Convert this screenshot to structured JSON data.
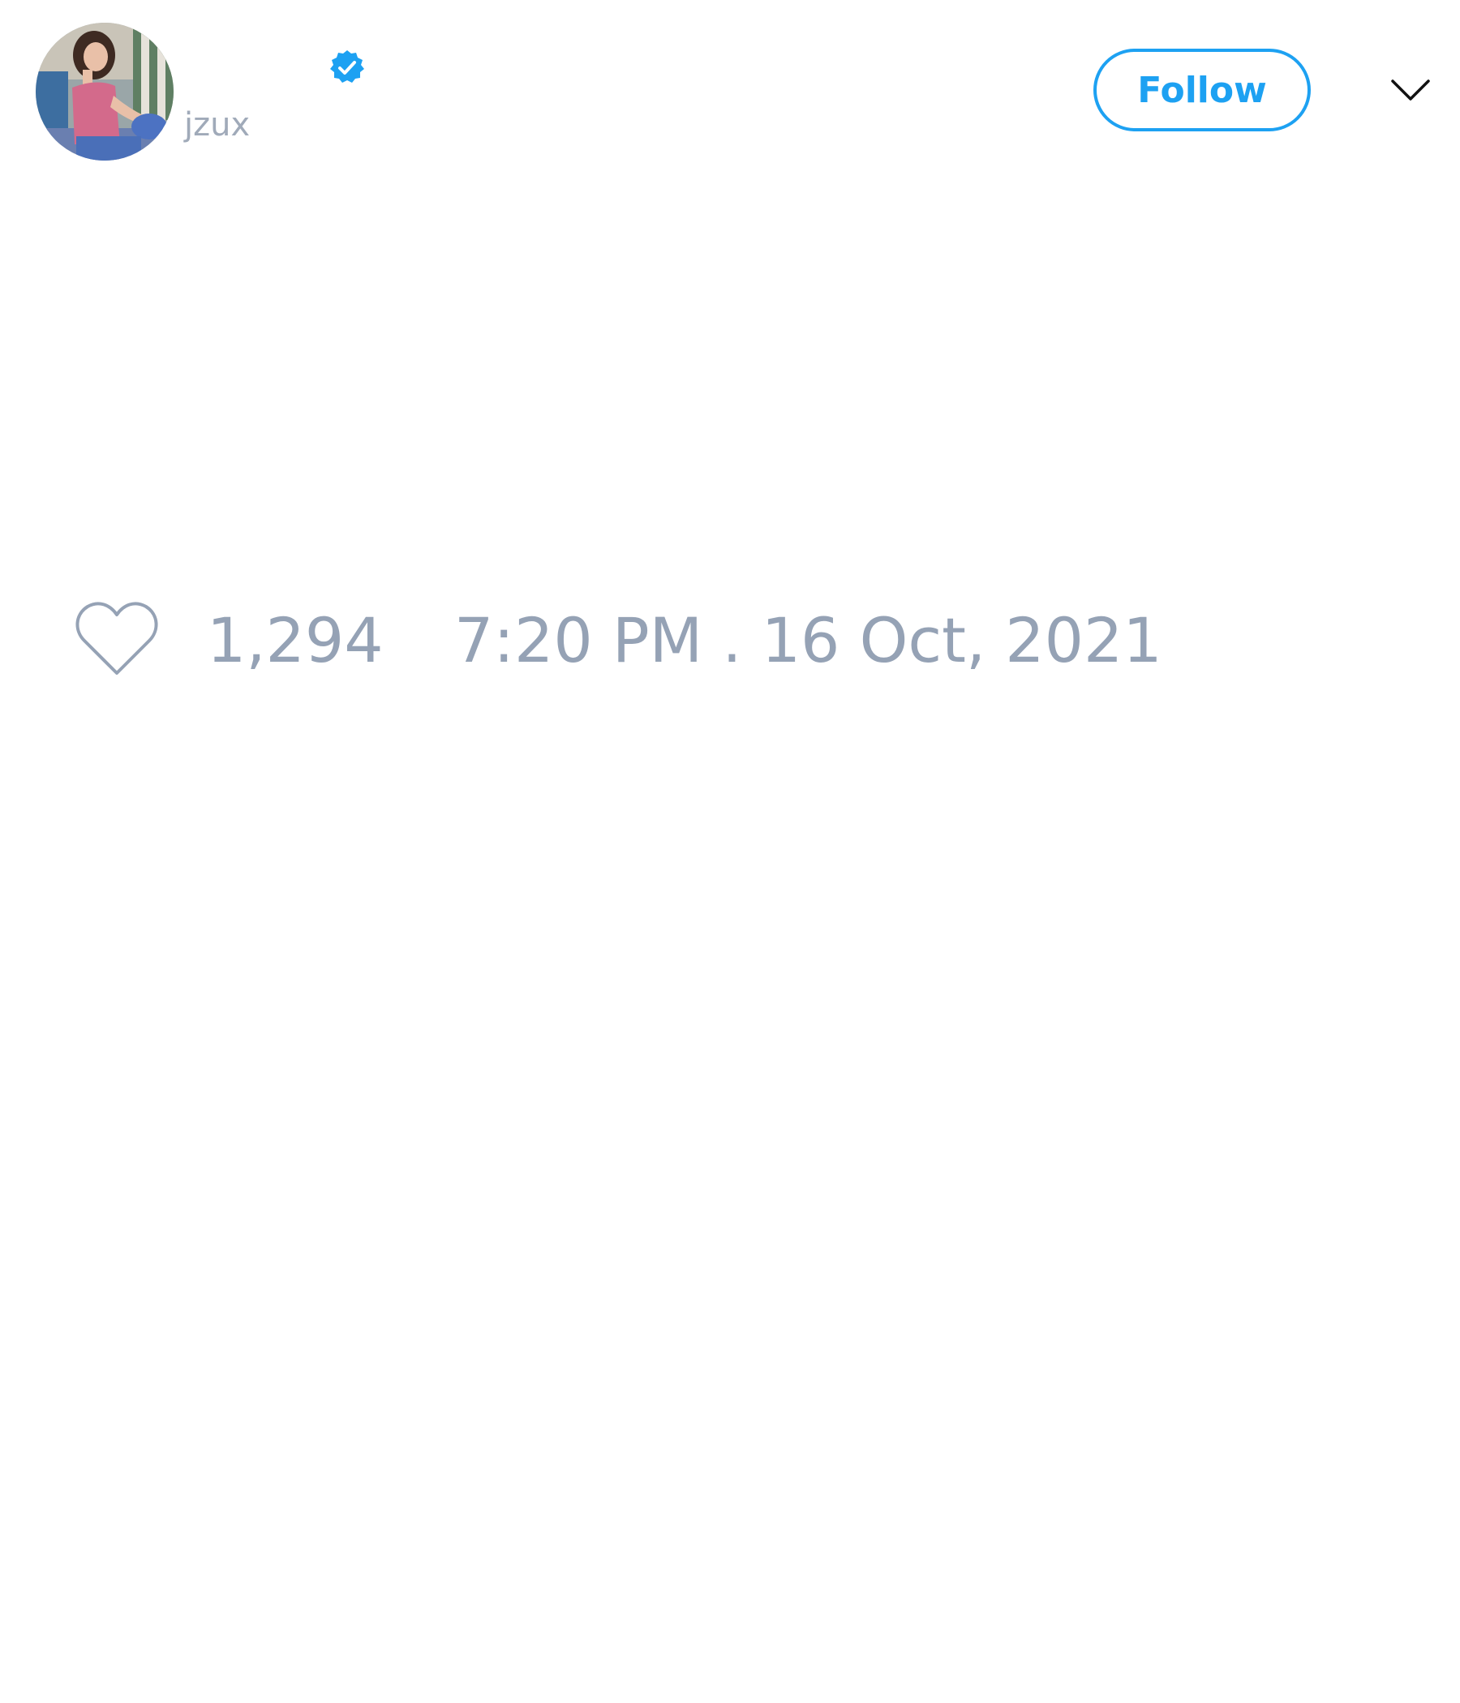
{
  "tweet": {
    "author": {
      "display_name": "",
      "handle": "jzux",
      "verified": true,
      "avatar_icon": "profile-photo"
    },
    "follow_label": "Follow",
    "menu_icon": "chevron-down-icon",
    "likes": {
      "icon": "heart-outline-icon",
      "count": "1,294"
    },
    "timestamp": "7:20 PM . 16 Oct, 2021"
  },
  "colors": {
    "accent": "#1da1f2",
    "muted_text": "#95a2b5",
    "handle_text": "#a0aab9",
    "background": "#ffffff"
  }
}
